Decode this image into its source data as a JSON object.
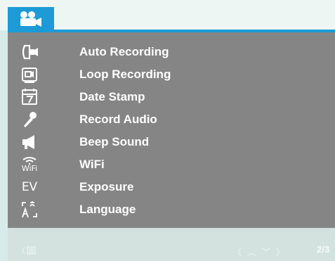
{
  "colors": {
    "accent": "#1c9bd6",
    "panel": "#858585",
    "text": "#ffffff"
  },
  "tab": {
    "icon": "video-camera-icon"
  },
  "menu": [
    {
      "label": "Auto Recording",
      "icon": "auto-record-camera-icon"
    },
    {
      "label": "Loop Recording",
      "icon": "loop-recording-icon"
    },
    {
      "label": "Date Stamp",
      "icon": "calendar-icon"
    },
    {
      "label": "Record Audio",
      "icon": "microphone-icon"
    },
    {
      "label": "Beep Sound",
      "icon": "speaker-icon"
    },
    {
      "label": "WiFi",
      "icon": "wifi-icon",
      "icon_text": "WiFi"
    },
    {
      "label": "Exposure",
      "icon": "ev-icon",
      "icon_text": "EV"
    },
    {
      "label": "Language",
      "icon": "language-icon"
    }
  ],
  "footer": {
    "back_icon": "menu-back-icon",
    "nav_arrows": "〈 ︿ ﹀ 〉",
    "page_indicator": "2/3"
  }
}
